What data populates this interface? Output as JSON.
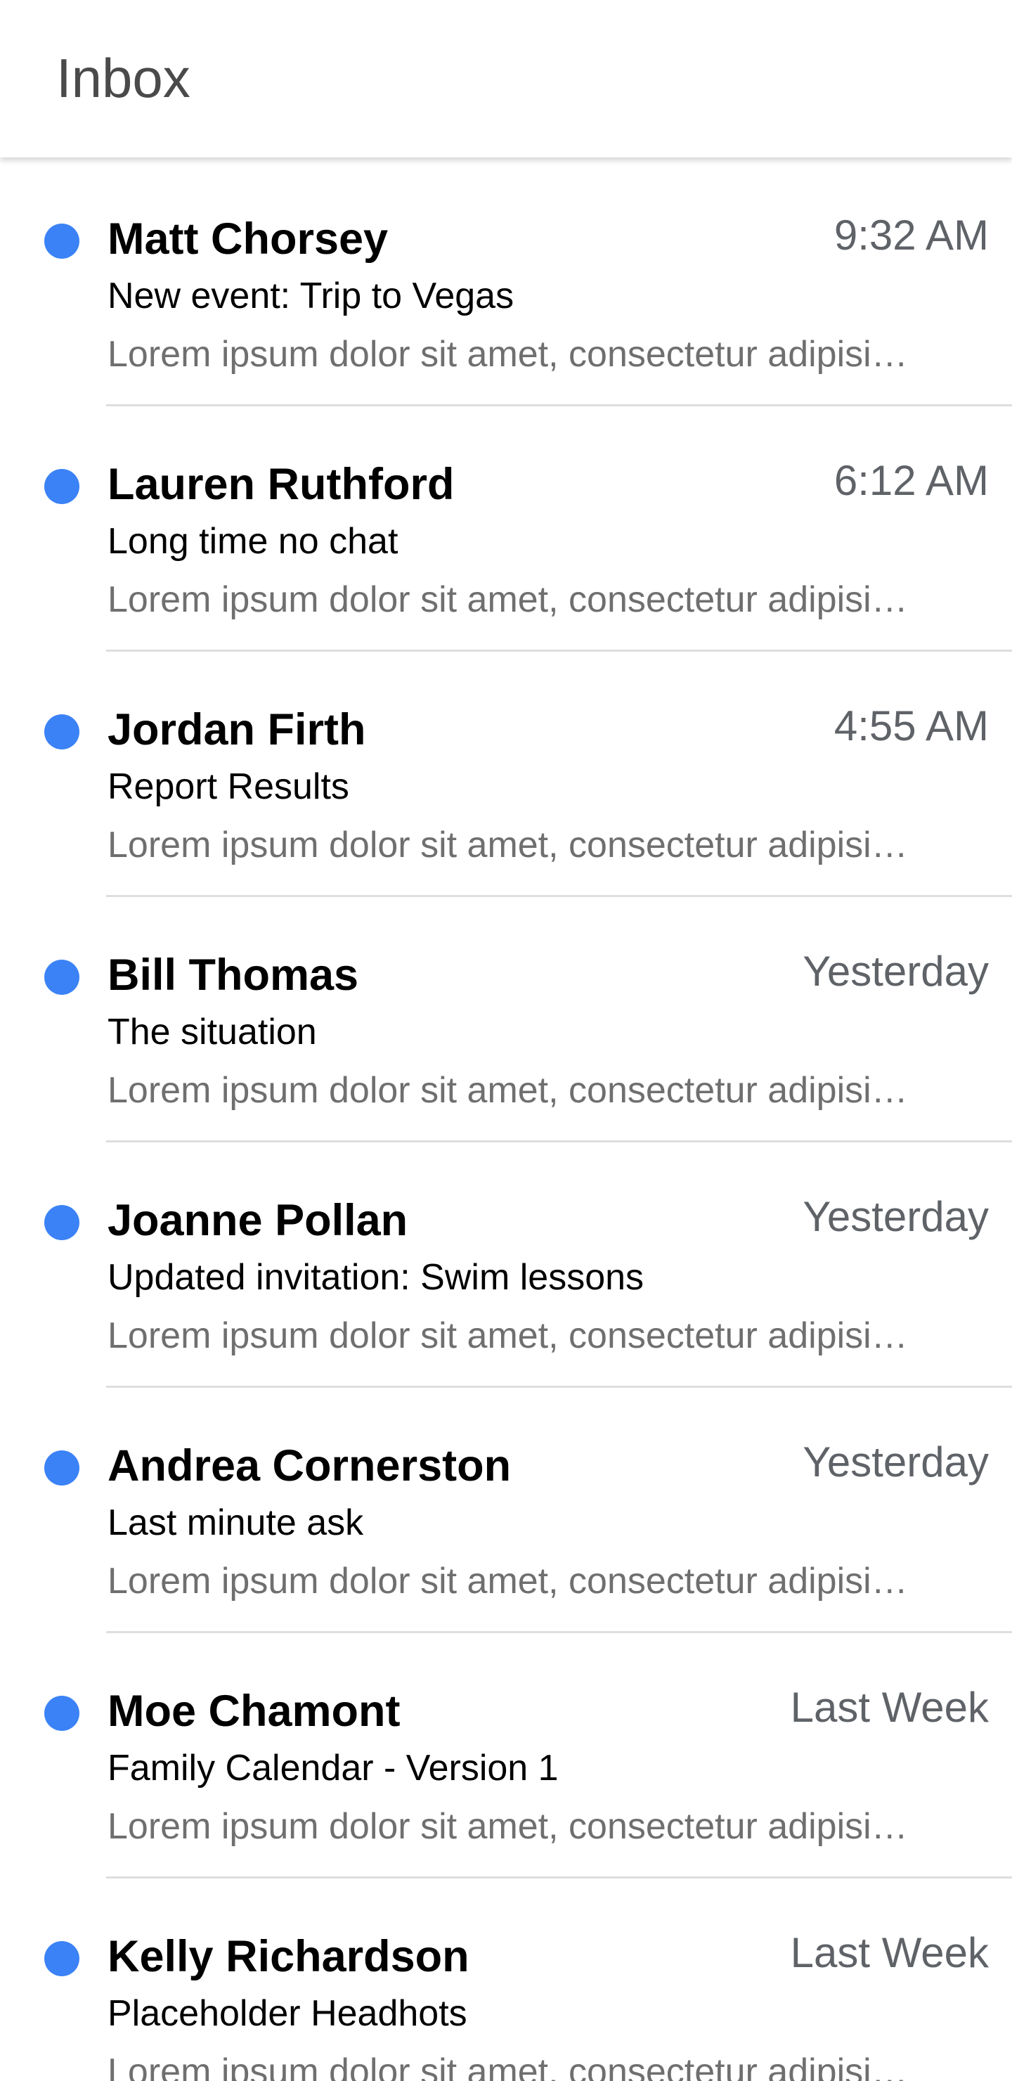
{
  "header": {
    "title": "Inbox"
  },
  "accent_color": "#3b82f6",
  "messages": [
    {
      "sender": "Matt Chorsey",
      "time": "9:32 AM",
      "subject": "New event: Trip to Vegas",
      "preview": "Lorem ipsum dolor sit amet, consectetur adipisi…",
      "unread": true
    },
    {
      "sender": "Lauren Ruthford",
      "time": "6:12 AM",
      "subject": "Long time no chat",
      "preview": "Lorem ipsum dolor sit amet, consectetur adipisi…",
      "unread": true
    },
    {
      "sender": "Jordan Firth",
      "time": "4:55 AM",
      "subject": "Report Results",
      "preview": "Lorem ipsum dolor sit amet, consectetur adipisi…",
      "unread": true
    },
    {
      "sender": "Bill Thomas",
      "time": "Yesterday",
      "subject": "The situation",
      "preview": "Lorem ipsum dolor sit amet, consectetur adipisi…",
      "unread": true
    },
    {
      "sender": "Joanne Pollan",
      "time": "Yesterday",
      "subject": "Updated invitation: Swim lessons",
      "preview": "Lorem ipsum dolor sit amet, consectetur adipisi…",
      "unread": true
    },
    {
      "sender": "Andrea Cornerston",
      "time": "Yesterday",
      "subject": "Last minute ask",
      "preview": "Lorem ipsum dolor sit amet, consectetur adipisi…",
      "unread": true
    },
    {
      "sender": "Moe Chamont",
      "time": "Last Week",
      "subject": "Family Calendar - Version 1",
      "preview": "Lorem ipsum dolor sit amet, consectetur adipisi…",
      "unread": true
    },
    {
      "sender": "Kelly Richardson",
      "time": "Last Week",
      "subject": "Placeholder Headhots",
      "preview": "Lorem ipsum dolor sit amet, consectetur adipisi…",
      "unread": true
    }
  ]
}
